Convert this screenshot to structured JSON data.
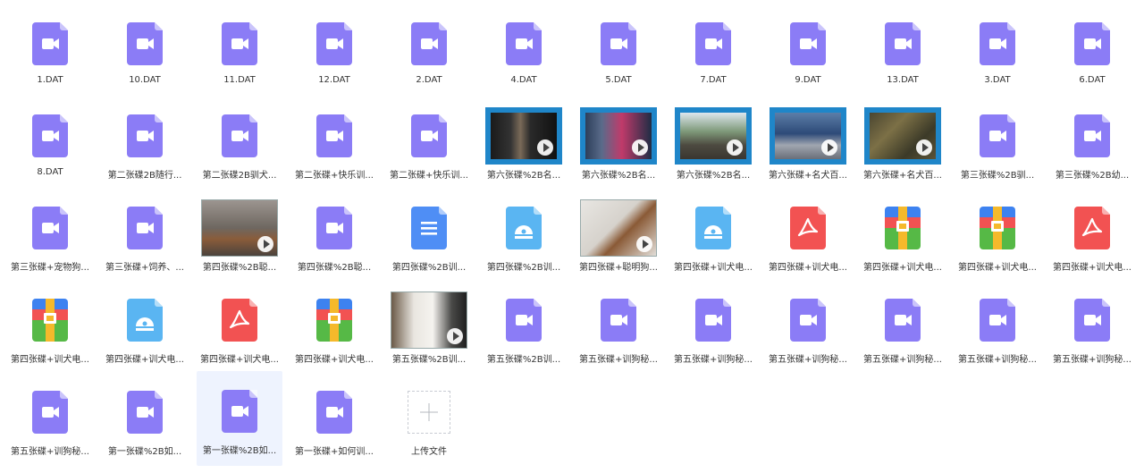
{
  "colors": {
    "video": "#8b7cf6",
    "doc": "#4f8ef5",
    "disc": "#5ab5f2",
    "pdf": "#f25252",
    "selected_bg": "#eef3fe"
  },
  "files": [
    {
      "name": "1.DAT",
      "type": "video"
    },
    {
      "name": "10.DAT",
      "type": "video"
    },
    {
      "name": "11.DAT",
      "type": "video"
    },
    {
      "name": "12.DAT",
      "type": "video"
    },
    {
      "name": "2.DAT",
      "type": "video"
    },
    {
      "name": "4.DAT",
      "type": "video"
    },
    {
      "name": "5.DAT",
      "type": "video"
    },
    {
      "name": "7.DAT",
      "type": "video"
    },
    {
      "name": "9.DAT",
      "type": "video"
    },
    {
      "name": "13.DAT",
      "type": "video"
    },
    {
      "name": "3.DAT",
      "type": "video"
    },
    {
      "name": "6.DAT",
      "type": "video"
    },
    {
      "name": "8.DAT",
      "type": "video"
    },
    {
      "name": "第二张碟2B随行...",
      "type": "video"
    },
    {
      "name": "第二张碟2B驯犬...",
      "type": "video"
    },
    {
      "name": "第二张碟+快乐训...",
      "type": "video"
    },
    {
      "name": "第二张碟+快乐训...",
      "type": "video"
    },
    {
      "name": "第六张碟%2B名...",
      "type": "thumb",
      "thumb": "hands"
    },
    {
      "name": "第六张碟%2B名...",
      "type": "thumb",
      "thumb": "stage"
    },
    {
      "name": "第六张碟%2B名...",
      "type": "thumb",
      "thumb": "street"
    },
    {
      "name": "第六张碟+名犬百...",
      "type": "thumb",
      "thumb": "person"
    },
    {
      "name": "第六张碟+名犬百...",
      "type": "thumb",
      "thumb": "grass"
    },
    {
      "name": "第三张碟%2B驯...",
      "type": "video"
    },
    {
      "name": "第三张碟%2B幼...",
      "type": "video"
    },
    {
      "name": "第三张碟+宠物狗...",
      "type": "video"
    },
    {
      "name": "第三张碟+饲养、...",
      "type": "video"
    },
    {
      "name": "第四张碟%2B聪...",
      "type": "thumb",
      "thumb": "dogs"
    },
    {
      "name": "第四张碟%2B聪...",
      "type": "video"
    },
    {
      "name": "第四张碟%2B训...",
      "type": "doc"
    },
    {
      "name": "第四张碟%2B训...",
      "type": "disc"
    },
    {
      "name": "第四张碟+聪明狗...",
      "type": "thumb",
      "thumb": "puppy"
    },
    {
      "name": "第四张碟+训犬电...",
      "type": "disc"
    },
    {
      "name": "第四张碟+训犬电...",
      "type": "pdf"
    },
    {
      "name": "第四张碟+训犬电...",
      "type": "zip"
    },
    {
      "name": "第四张碟+训犬电...",
      "type": "zip"
    },
    {
      "name": "第四张碟+训犬电...",
      "type": "pdf"
    },
    {
      "name": "第四张碟+训犬电...",
      "type": "zip"
    },
    {
      "name": "第四张碟+训犬电...",
      "type": "disc"
    },
    {
      "name": "第四张碟+训犬电...",
      "type": "pdf"
    },
    {
      "name": "第四张碟+训犬电...",
      "type": "zip"
    },
    {
      "name": "第五张碟%2B训...",
      "type": "thumb",
      "thumb": "white"
    },
    {
      "name": "第五张碟%2B训...",
      "type": "video"
    },
    {
      "name": "第五张碟+训狗秘...",
      "type": "video"
    },
    {
      "name": "第五张碟+训狗秘...",
      "type": "video"
    },
    {
      "name": "第五张碟+训狗秘...",
      "type": "video"
    },
    {
      "name": "第五张碟+训狗秘...",
      "type": "video"
    },
    {
      "name": "第五张碟+训狗秘...",
      "type": "video"
    },
    {
      "name": "第五张碟+训狗秘...",
      "type": "video"
    },
    {
      "name": "第五张碟+训狗秘...",
      "type": "video"
    },
    {
      "name": "第一张碟%2B如...",
      "type": "video"
    },
    {
      "name": "第一张碟%2B如...",
      "type": "video",
      "selected": true
    },
    {
      "name": "第一张碟+如何训...",
      "type": "video"
    },
    {
      "name": "上传文件",
      "type": "upload"
    }
  ]
}
